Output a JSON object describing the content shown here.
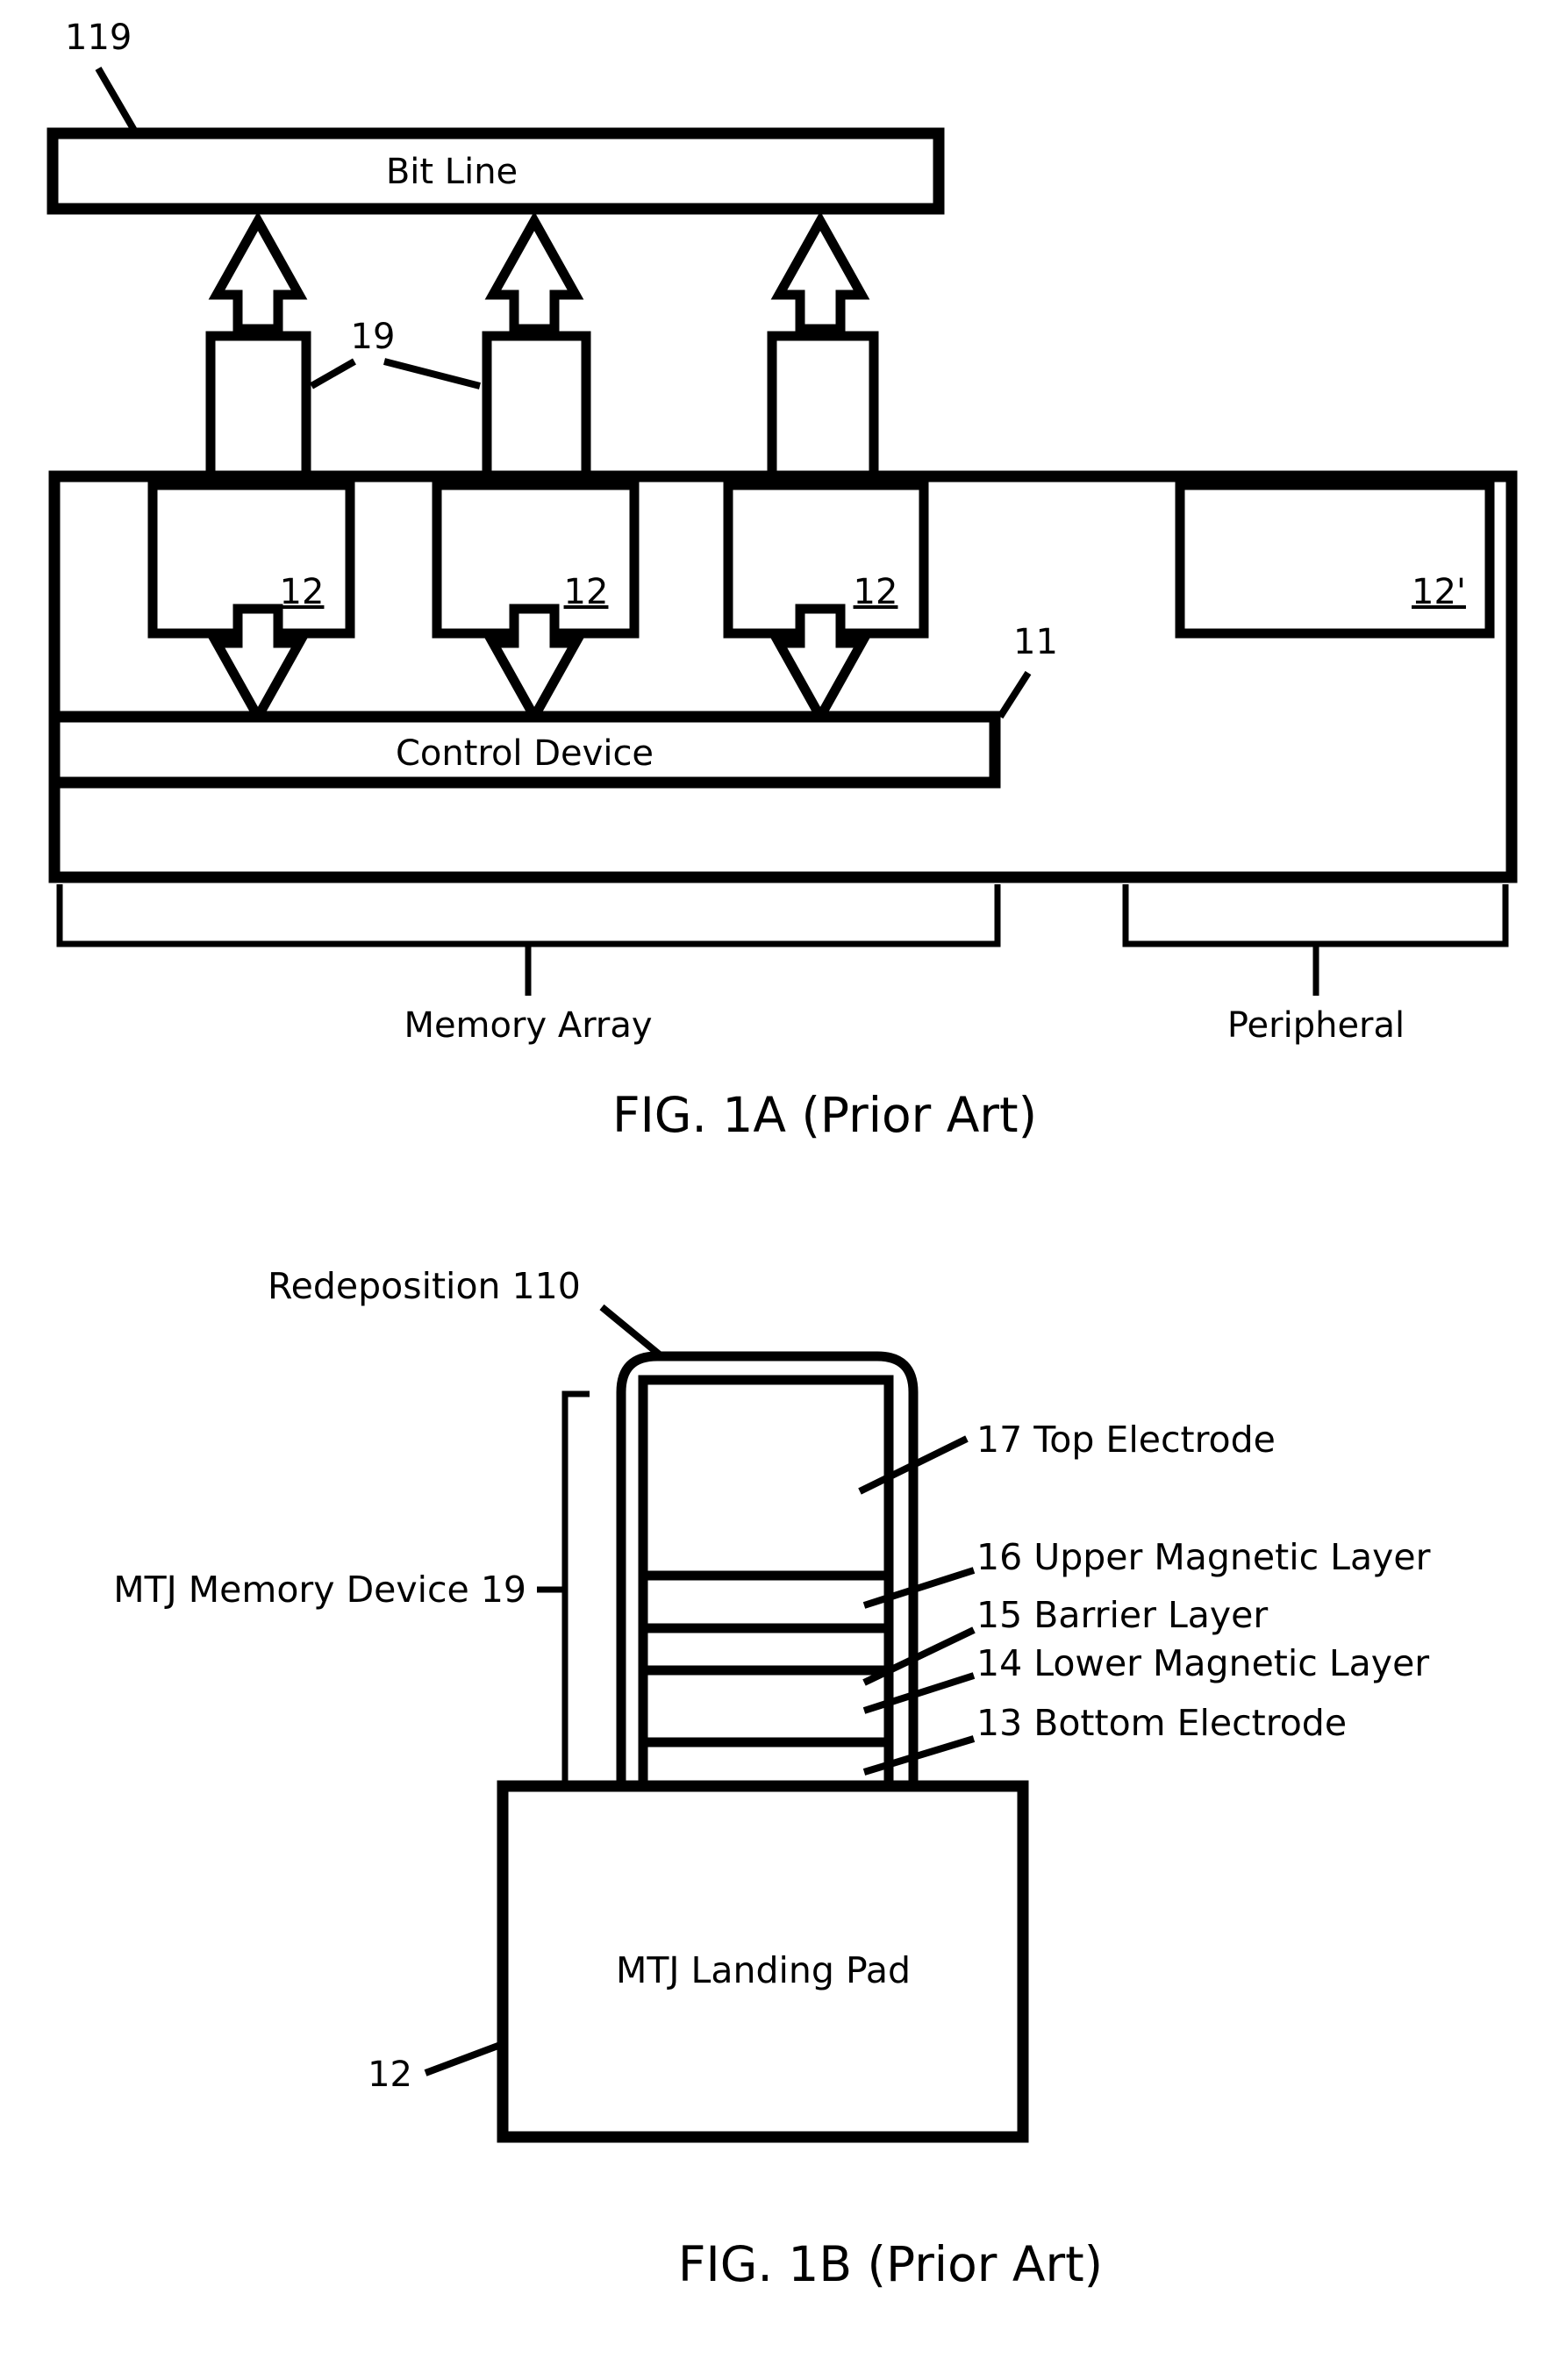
{
  "document": {
    "type": "patent-drawing-sheet",
    "background_color": "#ffffff",
    "ink_color": "#000000"
  },
  "figures": [
    {
      "id": "fig-1a",
      "caption": "FIG. 1A (Prior Art)",
      "elements": {
        "bit_line_label": "Bit Line",
        "bit_line_ref": "119",
        "mtj_pillar_ref": "19",
        "landing_pad_refs": [
          "12",
          "12",
          "12"
        ],
        "peripheral_pad_ref": "12'",
        "control_device_label": "Control Device",
        "control_device_ref": "11",
        "bracket_left_label": "Memory Array",
        "bracket_right_label": "Peripheral"
      }
    },
    {
      "id": "fig-1b",
      "caption": "FIG. 1B (Prior Art)",
      "elements": {
        "redeposition_label": "Redeposition 110",
        "device_bracket_label": "MTJ Memory Device 19",
        "landing_pad_label": "MTJ Landing Pad",
        "landing_pad_ref": "12",
        "stack_callouts": [
          {
            "ref": "17",
            "name": "Top Electrode"
          },
          {
            "ref": "16",
            "name": "Upper Magnetic Layer"
          },
          {
            "ref": "15",
            "name": "Barrier Layer"
          },
          {
            "ref": "14",
            "name": "Lower Magnetic Layer"
          },
          {
            "ref": "13",
            "name": "Bottom Electrode"
          }
        ],
        "stack_callout_text": [
          "17  Top Electrode",
          "16  Upper Magnetic Layer",
          "15  Barrier Layer",
          "14  Lower Magnetic Layer",
          "13  Bottom Electrode"
        ]
      }
    }
  ]
}
